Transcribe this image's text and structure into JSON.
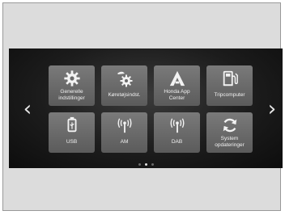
{
  "tiles": [
    {
      "label": "Generelle\nindstillinger",
      "icon": "gear-icon"
    },
    {
      "label": "Køretøjsindst.",
      "icon": "car-gear-icon"
    },
    {
      "label": "Honda App\nCenter",
      "icon": "app-center-icon"
    },
    {
      "label": "Tripcomputer",
      "icon": "fuel-pump-icon"
    },
    {
      "label": "USB",
      "icon": "usb-icon"
    },
    {
      "label": "AM",
      "icon": "radio-antenna-icon"
    },
    {
      "label": "DAB",
      "icon": "radio-antenna-icon"
    },
    {
      "label": "System\nopdateringer",
      "icon": "refresh-icon"
    }
  ],
  "nav": {
    "prev": "‹",
    "next": "›"
  },
  "pagination": {
    "pages": 3,
    "current": 2
  },
  "colors": {
    "tile": "#666666",
    "screen": "#1c1c1c",
    "text": "#f2f2f2"
  }
}
